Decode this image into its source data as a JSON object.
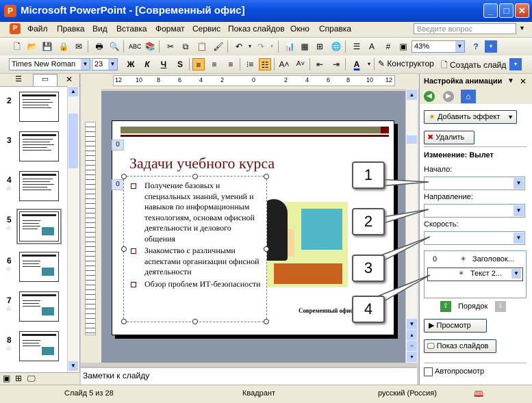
{
  "window": {
    "title": "Microsoft PowerPoint - [Современный офис]",
    "minimize": "_",
    "maximize": "□",
    "close": "✕"
  },
  "menu": [
    "Файл",
    "Правка",
    "Вид",
    "Вставка",
    "Формат",
    "Сервис",
    "Показ слайдов",
    "Окно",
    "Справка"
  ],
  "ask_placeholder": "Введите вопрос",
  "toolbar": {
    "zoom": "43%"
  },
  "format_toolbar": {
    "font": "Times New Roman",
    "size": "23",
    "bold": "Ж",
    "italic": "К",
    "underline": "Ч",
    "shadow": "S",
    "designer": "Конструктор",
    "new_slide": "Создать слайд"
  },
  "slides": [
    {
      "num": "2",
      "star": false
    },
    {
      "num": "3",
      "star": false
    },
    {
      "num": "4",
      "star": true
    },
    {
      "num": "5",
      "star": true,
      "selected": true
    },
    {
      "num": "6",
      "star": true
    },
    {
      "num": "7",
      "star": true
    },
    {
      "num": "8",
      "star": true
    }
  ],
  "slide": {
    "title": "Задачи учебного курса",
    "bullets": [
      "Получение базовых и специальных знаний, умений и навыков по информационным технологиям, основам офисной деятельности и делового общения",
      "Знакомство с различными аспектами организации офисной деятельности",
      "Обзор проблем ИТ-безопасности"
    ],
    "footer": "Современный офис",
    "anim_tag1": "0",
    "anim_tag2": "0"
  },
  "notes_placeholder": "Заметки к слайду",
  "taskpane": {
    "title": "Настройка анимации",
    "add_effect": "Добавить эффект",
    "remove": "Удалить",
    "change_label": "Изменение: Вылет",
    "start_label": "Начало:",
    "direction_label": "Направление:",
    "speed_label": "Скорость:",
    "list": [
      {
        "num": "0",
        "text": "Заголовок..."
      },
      {
        "num": "",
        "text": "Текст 2..."
      }
    ],
    "order_label": "Порядок",
    "preview": "Просмотр",
    "slideshow": "Показ слайдов",
    "autopreview": "Автопросмотр"
  },
  "callouts": [
    "1",
    "2",
    "3",
    "4"
  ],
  "status": {
    "slide": "Слайд 5 из 28",
    "design": "Квадрант",
    "lang": "русский (Россия)"
  },
  "ruler_labels": [
    "12",
    "10",
    "8",
    "6",
    "4",
    "2",
    "0",
    "2",
    "4",
    "6",
    "8",
    "10",
    "12"
  ]
}
